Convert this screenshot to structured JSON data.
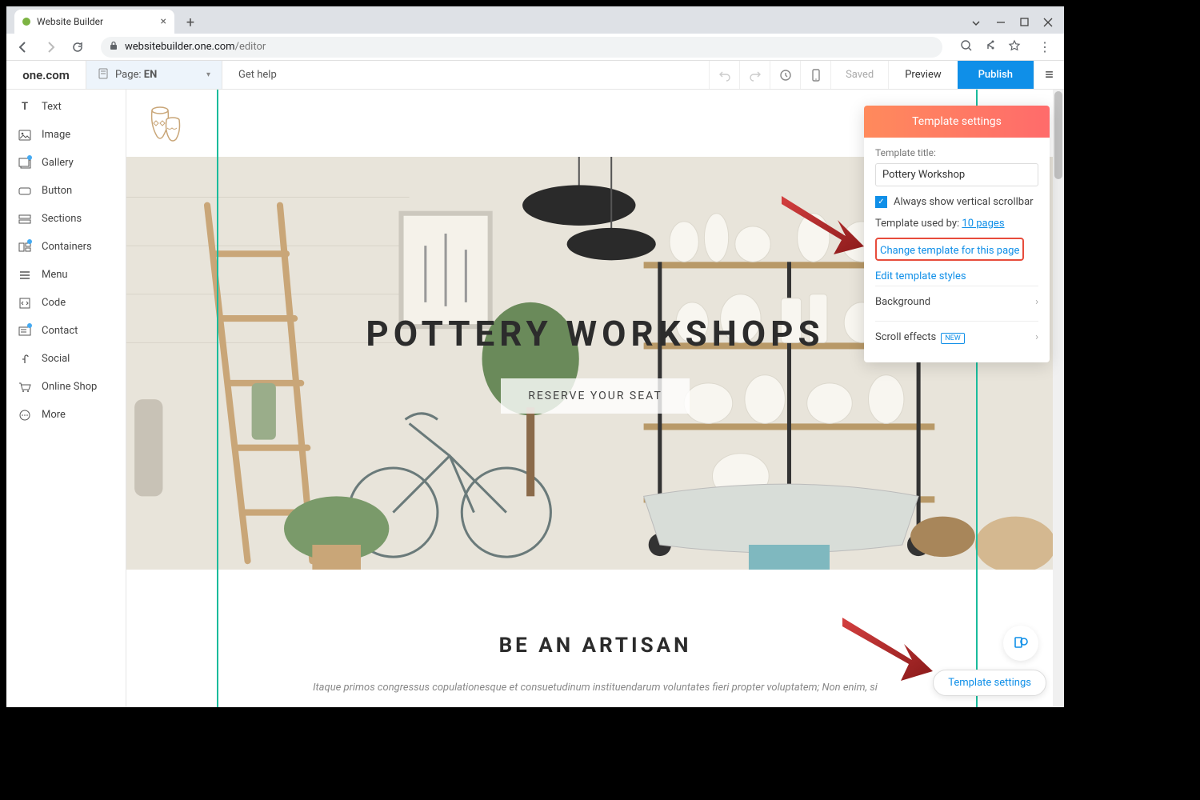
{
  "browser": {
    "tab_title": "Website Builder",
    "url_host": "websitebuilder.one.com",
    "url_path": "/editor"
  },
  "appbar": {
    "logo": "one.com",
    "page_label": "Page:",
    "page_lang": "EN",
    "help": "Get help",
    "saved": "Saved",
    "preview": "Preview",
    "publish": "Publish"
  },
  "sidebar": {
    "items": [
      {
        "label": "Text"
      },
      {
        "label": "Image"
      },
      {
        "label": "Gallery"
      },
      {
        "label": "Button"
      },
      {
        "label": "Sections"
      },
      {
        "label": "Containers"
      },
      {
        "label": "Menu"
      },
      {
        "label": "Code"
      },
      {
        "label": "Contact"
      },
      {
        "label": "Social"
      },
      {
        "label": "Online Shop"
      },
      {
        "label": "More"
      }
    ]
  },
  "hero": {
    "title": "POTTERY WORKSHOPS",
    "button": "RESERVE YOUR SEAT"
  },
  "section": {
    "title": "BE AN ARTISAN",
    "body": "Itaque primos congressus copulationesque et consuetudinum instituendarum voluntates fieri propter voluptatem; Non enim, si"
  },
  "panel": {
    "heading": "Template settings",
    "title_label": "Template title:",
    "title_value": "Pottery Workshop",
    "scrollbar_check": "Always show vertical scrollbar",
    "used_prefix": "Template used by:",
    "used_link": "10 pages",
    "change_template": "Change template for this page",
    "edit_styles": "Edit template styles",
    "background": "Background",
    "scroll_effects": "Scroll effects",
    "new_badge": "NEW"
  },
  "float": {
    "chip": "Template settings"
  }
}
